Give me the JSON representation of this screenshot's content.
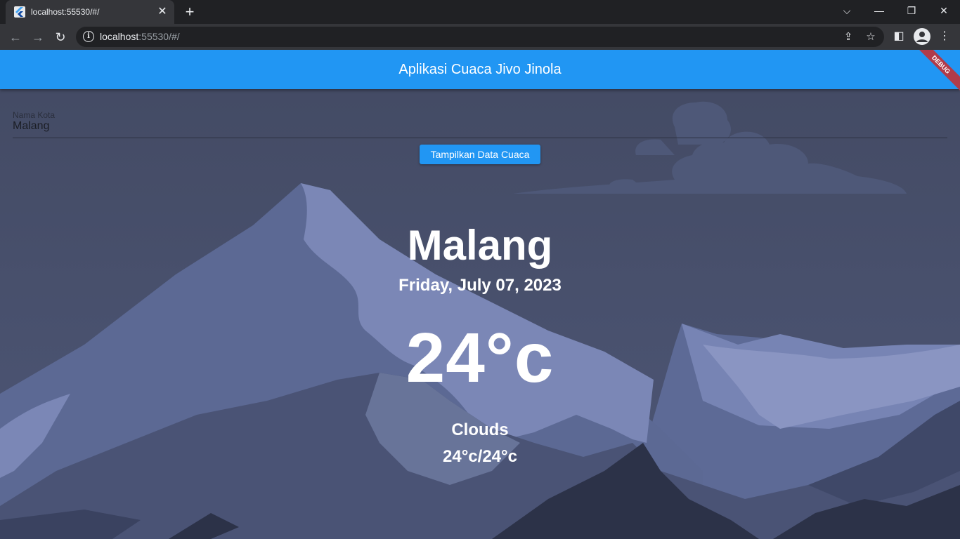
{
  "browser": {
    "tab_title": "localhost:55530/#/",
    "url_host": "localhost",
    "url_rest": ":55530/#/"
  },
  "app": {
    "title": "Aplikasi Cuaca Jivo Jinola",
    "debug_label": "DEBUG"
  },
  "form": {
    "city_label": "Nama Kota",
    "city_value": "Malang",
    "fetch_button": "Tampilkan Data Cuaca"
  },
  "weather": {
    "city": "Malang",
    "date": "Friday, July 07, 2023",
    "temperature": "24°c",
    "description": "Clouds",
    "min_max": "24°c/24°c"
  },
  "colors": {
    "accent": "#2196f3",
    "background": "#454d66"
  }
}
